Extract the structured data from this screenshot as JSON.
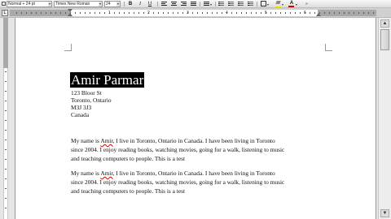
{
  "toolbar": {
    "style": "Normal + 24 pt",
    "font": "Times New Roman",
    "size": "24",
    "bold_label": "B",
    "italic_label": "I",
    "underline_label": "U",
    "font_color_label": "A",
    "highlight_color": "#ffea00",
    "font_color": "#d00000"
  },
  "ruler": {
    "tab_selector": "L",
    "numbers": [
      "1",
      "2",
      "3",
      "4",
      "5",
      "6"
    ]
  },
  "document": {
    "name": "Amir Parmar",
    "address": [
      "123 Bloor St",
      "Toronto, Ontario",
      "M3J 3J3",
      "Canada"
    ],
    "paragraphs": [
      {
        "lines": [
          [
            "My name is ",
            "Amir",
            ", I live in Toronto, Ontario in Canada. I have been living in Toronto"
          ],
          "since 2004. I enjoy reading books, watching movies, going for a walk, listening to music",
          "and teaching computers to people. This is a test"
        ]
      },
      {
        "lines": [
          [
            "My name is ",
            "Amir",
            ", I live in Toronto, Ontario in Canada. I have been living in Toronto"
          ],
          "since 2004. I enjoy reading books, watching movies, going for a walk, listening to music",
          "and teaching computers to people. This is a test"
        ]
      }
    ]
  }
}
